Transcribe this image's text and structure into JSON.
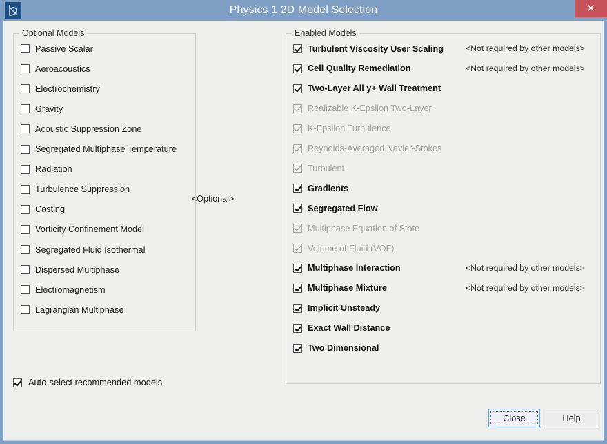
{
  "window": {
    "title": "Physics 1 2D Model Selection",
    "app_icon": "star-ccm-logo-icon",
    "close_icon": "close-icon",
    "close_label": "✕",
    "titlebar_color": "#7f9fc4",
    "close_button_color": "#c7525a",
    "client_color": "#efefee"
  },
  "optional_panel": {
    "legend": "Optional Models",
    "items": [
      {
        "label": "Passive Scalar",
        "checked": false
      },
      {
        "label": "Aeroacoustics",
        "checked": false
      },
      {
        "label": "Electrochemistry",
        "checked": false
      },
      {
        "label": "Gravity",
        "checked": false
      },
      {
        "label": "Acoustic Suppression Zone",
        "checked": false
      },
      {
        "label": "Segregated Multiphase Temperature",
        "checked": false
      },
      {
        "label": "Radiation",
        "checked": false
      },
      {
        "label": "Turbulence Suppression",
        "checked": false
      },
      {
        "label": "Casting",
        "checked": false
      },
      {
        "label": "Vorticity Confinement Model",
        "checked": false
      },
      {
        "label": "Segregated Fluid Isothermal",
        "checked": false
      },
      {
        "label": "Dispersed Multiphase",
        "checked": false
      },
      {
        "label": "Electromagnetism",
        "checked": false
      },
      {
        "label": "Lagrangian Multiphase",
        "checked": false
      }
    ]
  },
  "middle_marker": "<Optional>",
  "enabled_panel": {
    "legend": "Enabled Models",
    "items": [
      {
        "label": "Turbulent Viscosity User Scaling",
        "checked": true,
        "disabled": false,
        "note": "<Not required by other models>"
      },
      {
        "label": "Cell Quality Remediation",
        "checked": true,
        "disabled": false,
        "note": "<Not required by other models>"
      },
      {
        "label": "Two-Layer All y+ Wall Treatment",
        "checked": true,
        "disabled": false,
        "note": ""
      },
      {
        "label": "Realizable K-Epsilon Two-Layer",
        "checked": true,
        "disabled": true,
        "note": ""
      },
      {
        "label": "K-Epsilon Turbulence",
        "checked": true,
        "disabled": true,
        "note": ""
      },
      {
        "label": "Reynolds-Averaged Navier-Stokes",
        "checked": true,
        "disabled": true,
        "note": ""
      },
      {
        "label": "Turbulent",
        "checked": true,
        "disabled": true,
        "note": ""
      },
      {
        "label": "Gradients",
        "checked": true,
        "disabled": false,
        "note": ""
      },
      {
        "label": "Segregated Flow",
        "checked": true,
        "disabled": false,
        "note": ""
      },
      {
        "label": "Multiphase Equation of State",
        "checked": true,
        "disabled": true,
        "note": ""
      },
      {
        "label": "Volume of Fluid (VOF)",
        "checked": true,
        "disabled": true,
        "note": ""
      },
      {
        "label": "Multiphase Interaction",
        "checked": true,
        "disabled": false,
        "note": "<Not required by other models>"
      },
      {
        "label": "Multiphase Mixture",
        "checked": true,
        "disabled": false,
        "note": "<Not required by other models>"
      },
      {
        "label": "Implicit Unsteady",
        "checked": true,
        "disabled": false,
        "note": ""
      },
      {
        "label": "Exact Wall Distance",
        "checked": true,
        "disabled": false,
        "note": ""
      },
      {
        "label": "Two Dimensional",
        "checked": true,
        "disabled": false,
        "note": ""
      }
    ]
  },
  "auto_select": {
    "label": "Auto-select recommended models",
    "checked": true
  },
  "buttons": {
    "close": "Close",
    "help": "Help"
  }
}
